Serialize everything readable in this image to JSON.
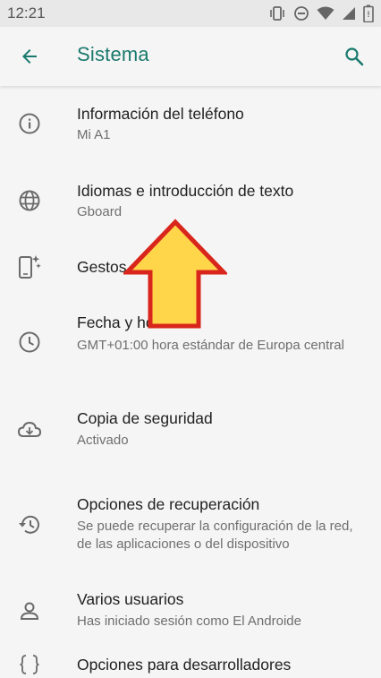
{
  "status_bar": {
    "time": "12:21",
    "icons": [
      "vibrate-icon",
      "do-not-disturb-icon",
      "wifi-icon",
      "signal-icon",
      "battery-icon"
    ]
  },
  "app_bar": {
    "title": "Sistema",
    "back_icon": "arrow-back-icon",
    "search_icon": "search-icon",
    "accent_color": "#1a7a6d"
  },
  "settings": [
    {
      "title": "Información del teléfono",
      "subtitle": "Mi A1",
      "icon": "info-icon"
    },
    {
      "title": "Idiomas e introducción de texto",
      "subtitle": "Gboard",
      "icon": "globe-icon"
    },
    {
      "title": "Gestos",
      "subtitle": "",
      "icon": "gestures-phone-icon"
    },
    {
      "title": "Fecha y hora",
      "subtitle": "GMT+01:00 hora estándar de Europa central",
      "icon": "clock-icon"
    },
    {
      "title": "Copia de seguridad",
      "subtitle": "Activado",
      "icon": "cloud-backup-icon"
    },
    {
      "title": "Opciones de recuperación",
      "subtitle": "Se puede recuperar la configuración de la red, de las aplicaciones o del dispositivo",
      "icon": "restore-history-icon"
    },
    {
      "title": "Varios usuarios",
      "subtitle": "Has iniciado sesión como El Androide",
      "icon": "person-icon"
    },
    {
      "title": "Opciones para desarrolladores",
      "subtitle": "",
      "icon": "braces-icon"
    }
  ],
  "annotation": {
    "arrow_fill": "#ffd54a",
    "arrow_stroke": "#d9261c",
    "icon": "up-arrow-annotation"
  }
}
